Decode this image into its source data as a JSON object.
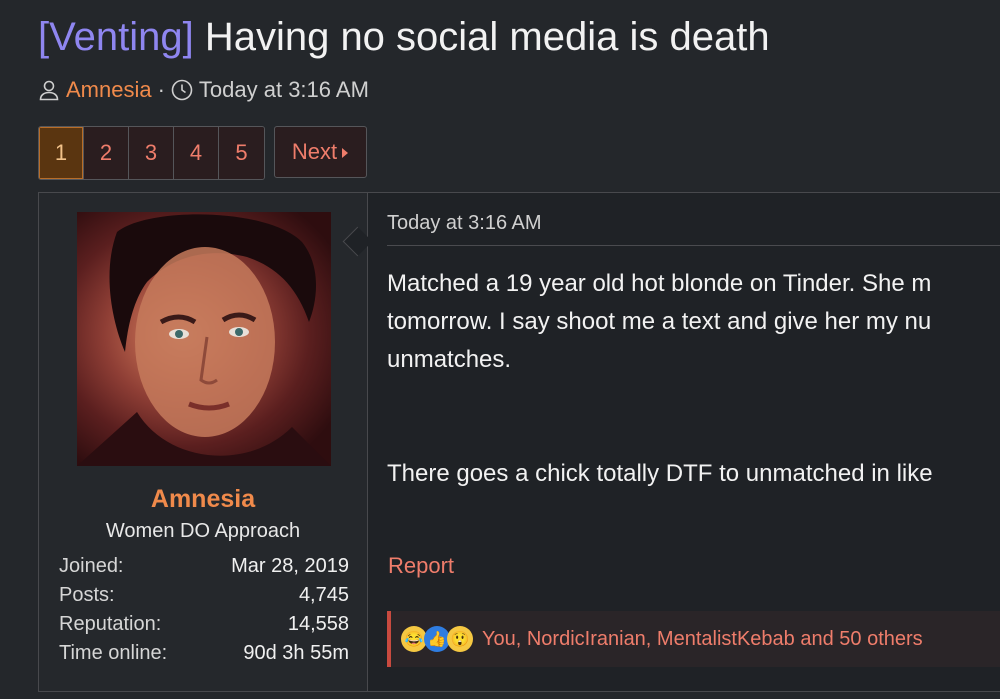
{
  "thread": {
    "prefix": "[Venting]",
    "title": "Having no social media is death",
    "author": "Amnesia",
    "separator": "·",
    "date": "Today at 3:16 AM"
  },
  "pagination": {
    "pages": [
      "1",
      "2",
      "3",
      "4",
      "5"
    ],
    "current": "1",
    "next_label": "Next"
  },
  "post": {
    "user": {
      "name": "Amnesia",
      "title": "Women DO Approach",
      "stats": [
        {
          "label": "Joined:",
          "value": "Mar 28, 2019"
        },
        {
          "label": "Posts:",
          "value": "4,745"
        },
        {
          "label": "Reputation:",
          "value": "14,558"
        },
        {
          "label": "Time online:",
          "value": "90d 3h 55m"
        }
      ]
    },
    "date": "Today at 3:16 AM",
    "body_lines": [
      "Matched a 19 year old hot blonde on Tinder. She m",
      "tomorrow. I say shoot me a text and give her my nu",
      "unmatches."
    ],
    "body_para2": "There goes a chick totally DTF to unmatched in like",
    "report_label": "Report",
    "reactions": {
      "emojis": [
        "laughing-emoji",
        "like-emoji",
        "wow-emoji"
      ],
      "text": "You, NordicIranian, MentalistKebab and 50 others"
    }
  },
  "colors": {
    "background": "#24272b",
    "prefix": "#8f86f0",
    "username": "#f08a4b",
    "link": "#ef7d6b",
    "current_page": "#5a3510"
  }
}
